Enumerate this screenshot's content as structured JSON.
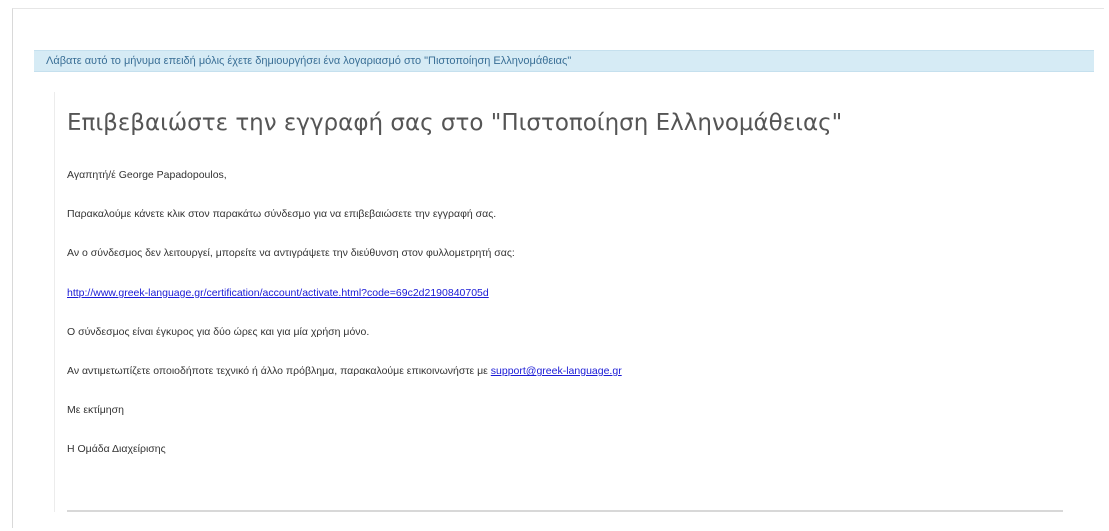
{
  "notice": {
    "text": "Λάβατε αυτό το μήνυμα επειδή μόλις έχετε δημιουργήσει ένα λογαριασμό στο \"Πιστοποίηση Ελληνομάθειας\""
  },
  "email": {
    "title": "Επιβεβαιώστε την εγγραφή σας στο \"Πιστοποίηση Ελληνομάθειας\"",
    "greeting": "Αγαπητή/έ George Papadopoulos,",
    "instruction": "Παρακαλούμε κάνετε κλικ στον παρακάτω σύνδεσμο για να επιβεβαιώσετε την εγγραφή σας.",
    "fallback": "Αν ο σύνδεσμος δεν λειτουργεί, μπορείτε να αντιγράψετε την διεύθυνση στον φυλλομετρητή σας:",
    "activation_link": "http://www.greek-language.gr/certification/account/activate.html?code=69c2d2190840705d",
    "validity": "Ο σύνδεσμος είναι έγκυρος για δύο ώρες και για μία χρήση μόνο.",
    "support_text": "Αν αντιμετωπίζετε οποιοδήποτε τεχνικό ή άλλο πρόβλημα, παρακαλούμε επικοινωνήστε με",
    "support_email": "support@greek-language.gr",
    "closing": "Με εκτίμηση",
    "signature": "Η Ομάδα Διαχείρισης"
  }
}
